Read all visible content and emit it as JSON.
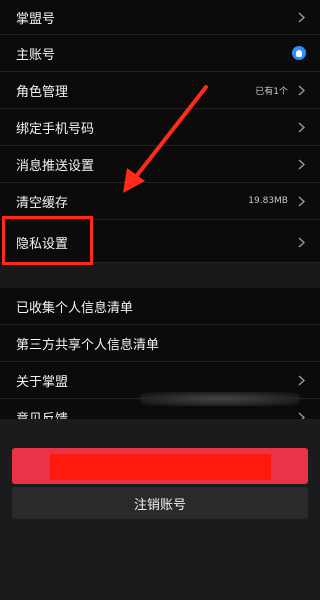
{
  "settings": {
    "rows": [
      {
        "label": "掌盟号",
        "value": "",
        "chevron": true
      },
      {
        "label": "主账号",
        "value": "",
        "chevron": false,
        "icon": "qq-icon"
      },
      {
        "label": "角色管理",
        "value": "已有1个",
        "chevron": true
      },
      {
        "label": "绑定手机号码",
        "value": "",
        "chevron": true
      },
      {
        "label": "消息推送设置",
        "value": "",
        "chevron": true
      },
      {
        "label": "清空缓存",
        "value": "19.83MB",
        "chevron": true
      },
      {
        "label": "隐私设置",
        "value": "",
        "chevron": true
      }
    ],
    "rows2": [
      {
        "label": "已收集个人信息清单",
        "value": "",
        "chevron": false
      },
      {
        "label": "第三方共享个人信息清单",
        "value": "",
        "chevron": false
      },
      {
        "label": "关于掌盟",
        "value": "",
        "chevron": true
      },
      {
        "label": "意见反馈",
        "value": "",
        "chevron": true
      }
    ]
  },
  "actions": {
    "logout_label": "",
    "cancel_account_label": "注销账号"
  },
  "colors": {
    "accent_red": "#e93347",
    "annotation_red": "#ff2a1a",
    "qq_blue": "#2f8cff"
  }
}
